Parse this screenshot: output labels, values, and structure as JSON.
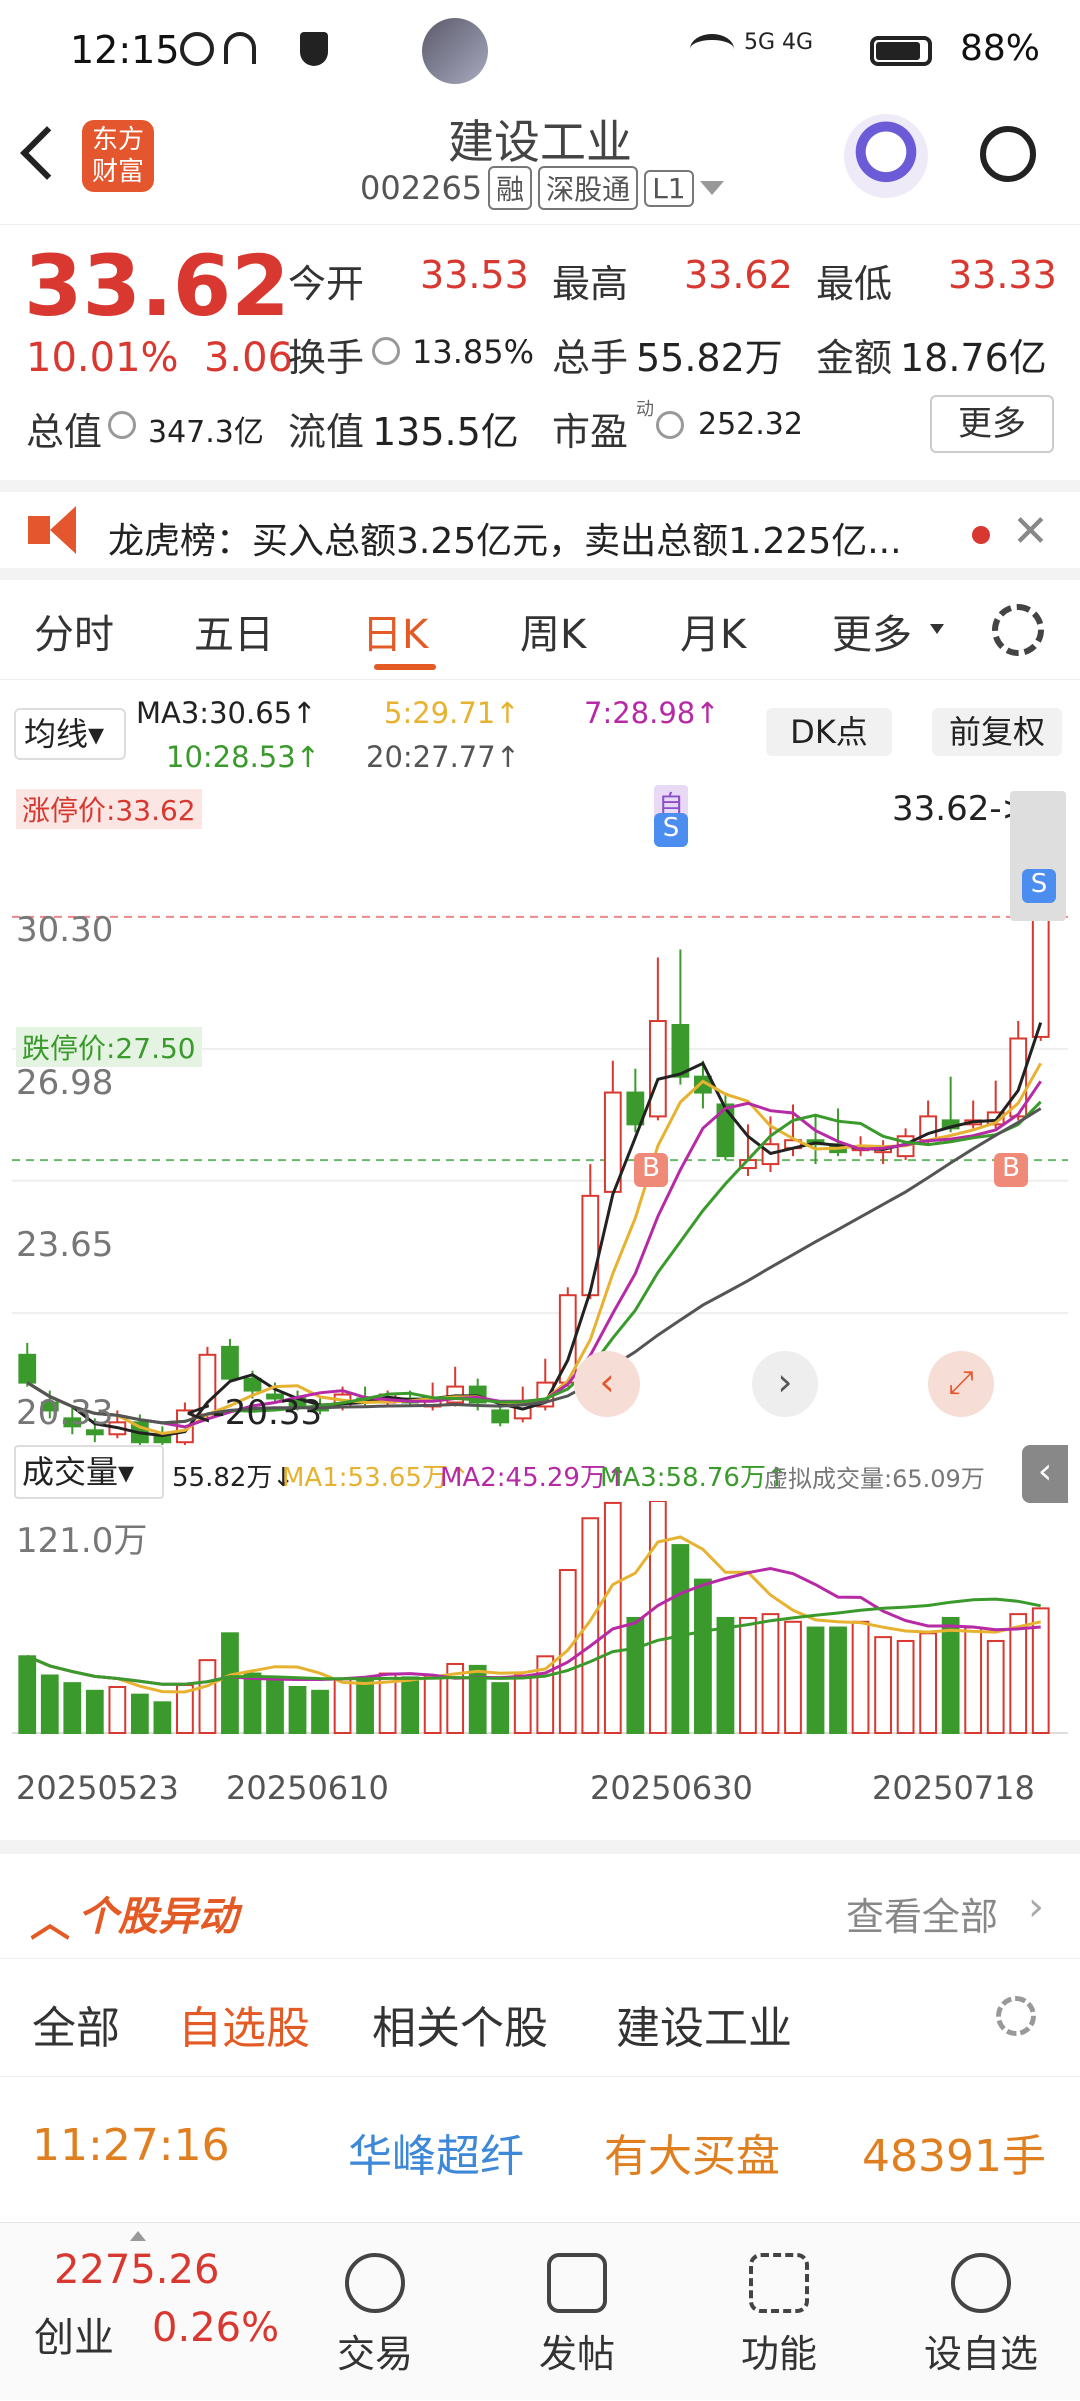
{
  "status": {
    "time": "12:15",
    "battery": "88%",
    "net": "5G 4G"
  },
  "nav": {
    "title": "建设工业",
    "code": "002265",
    "tag1": "融",
    "tag2": "深股通",
    "tag3": "L1",
    "logo_text": "东方财富",
    "back_icon": "chevron-left-icon",
    "search_icon": "search-icon"
  },
  "quote": {
    "price": "33.62",
    "change_pct": "10.01%",
    "change_amt": "3.06",
    "open_label": "今开",
    "open": "33.53",
    "high_label": "最高",
    "high": "33.62",
    "low_label": "最低",
    "low": "33.33",
    "turnover_label": "换手",
    "turnover": "13.85%",
    "volume_label": "总手",
    "volume": "55.82万",
    "amount_label": "金额",
    "amount": "18.76亿",
    "mktcap_label": "总值",
    "mktcap": "347.3亿",
    "float_label": "流值",
    "float": "135.5亿",
    "pe_label": "市盈",
    "pe_sup": "动",
    "pe": "252.32",
    "more": "更多"
  },
  "notice": {
    "text": "龙虎榜：买入总额3.25亿元，卖出总额1.225亿..."
  },
  "tabs": [
    {
      "label": "分时"
    },
    {
      "label": "五日"
    },
    {
      "label": "日K"
    },
    {
      "label": "周K"
    },
    {
      "label": "月K"
    },
    {
      "label": "更多"
    }
  ],
  "chart_controls": {
    "indicator": "均线",
    "ma3": "MA3:30.65↑",
    "ma5": "5:29.71↑",
    "ma7": "7:28.98↑",
    "ma10": "10:28.53↑",
    "ma20": "20:27.77↑",
    "dk": "DK点",
    "adjust": "前复权"
  },
  "kline": {
    "limit_up_label": "涨停价:33.62",
    "limit_down_label": "跌停价:27.50",
    "y_top": "36.?",
    "y1": "30.30",
    "y2": "26.98",
    "y3": "23.65",
    "y4": "20.33",
    "low_marker": "<-20.33",
    "last_marker": "33.62->",
    "self_tag": "自"
  },
  "volume": {
    "indicator": "成交量",
    "vol": "55.82万↓",
    "ma1": "MA1:53.65万↑",
    "ma2": "MA2:45.29万↑",
    "ma3": "MA3:58.76万↑",
    "virtual": "虚拟成交量:65.09万",
    "ytop": "121.0万",
    "dates": [
      "20250523",
      "20250610",
      "20250630",
      "20250718"
    ]
  },
  "movers": {
    "title": "个股异动",
    "view_all": "查看全部",
    "tabs": [
      {
        "label": "全部"
      },
      {
        "label": "自选股"
      },
      {
        "label": "相关个股"
      },
      {
        "label": "建设工业"
      }
    ],
    "row": {
      "time": "11:27:16",
      "name": "华峰超纤",
      "event": "有大买盘",
      "qty": "48391手"
    }
  },
  "bottom": {
    "index_value": "2275.26",
    "index_name": "创业",
    "index_chg": "0.26%",
    "items": [
      {
        "label": "交易"
      },
      {
        "label": "发帖"
      },
      {
        "label": "功能"
      },
      {
        "label": "设自选"
      }
    ]
  },
  "colors": {
    "up": "#d8382f",
    "down": "#3a9a2c",
    "accent": "#e45a24"
  },
  "chart_data": {
    "type": "candlestick",
    "ylim": [
      20.33,
      36.94
    ],
    "dates_shown": [
      "20250523",
      "20250610",
      "20250630",
      "20250718"
    ],
    "candles": [
      [
        22.6,
        21.9,
        22.9,
        21.8
      ],
      [
        21.4,
        21.2,
        21.7,
        21.0
      ],
      [
        21.0,
        20.8,
        21.3,
        20.6
      ],
      [
        20.7,
        20.6,
        21.0,
        20.4
      ],
      [
        20.6,
        20.9,
        21.2,
        20.5
      ],
      [
        20.9,
        20.4,
        21.1,
        20.33
      ],
      [
        20.6,
        20.4,
        20.8,
        20.33
      ],
      [
        20.4,
        21.2,
        21.4,
        20.3
      ],
      [
        21.1,
        22.6,
        22.8,
        21.0
      ],
      [
        22.8,
        22.0,
        23.0,
        21.9
      ],
      [
        22.0,
        21.7,
        22.2,
        21.5
      ],
      [
        21.6,
        21.5,
        21.9,
        21.4
      ],
      [
        21.5,
        21.3,
        21.7,
        21.2
      ],
      [
        21.3,
        21.2,
        21.5,
        21.1
      ],
      [
        21.3,
        21.6,
        21.8,
        21.2
      ],
      [
        21.5,
        21.4,
        21.8,
        21.3
      ],
      [
        21.4,
        21.6,
        21.7,
        21.3
      ],
      [
        21.5,
        21.4,
        21.7,
        21.3
      ],
      [
        21.3,
        21.5,
        21.9,
        21.2
      ],
      [
        21.4,
        21.8,
        22.3,
        21.3
      ],
      [
        21.8,
        21.4,
        22.0,
        21.2
      ],
      [
        21.2,
        20.9,
        21.4,
        20.8
      ],
      [
        21.0,
        21.4,
        21.8,
        20.9
      ],
      [
        21.3,
        21.9,
        22.5,
        21.2
      ],
      [
        21.9,
        24.1,
        24.3,
        21.8
      ],
      [
        24.1,
        26.6,
        27.4,
        24.0
      ],
      [
        26.7,
        29.2,
        30.0,
        26.6
      ],
      [
        29.2,
        28.4,
        29.8,
        28.2
      ],
      [
        28.6,
        31.0,
        32.6,
        28.5
      ],
      [
        30.9,
        29.6,
        32.8,
        29.4
      ],
      [
        29.6,
        29.2,
        30.0,
        28.8
      ],
      [
        28.9,
        27.6,
        29.2,
        27.5
      ],
      [
        27.3,
        27.5,
        28.4,
        27.1
      ],
      [
        27.4,
        27.9,
        28.6,
        27.2
      ],
      [
        27.8,
        28.0,
        28.9,
        27.6
      ],
      [
        28.0,
        27.9,
        28.6,
        27.4
      ],
      [
        27.9,
        27.7,
        28.8,
        27.6
      ],
      [
        27.8,
        27.8,
        28.1,
        27.6
      ],
      [
        27.7,
        27.8,
        28.0,
        27.4
      ],
      [
        27.6,
        28.1,
        28.3,
        27.5
      ],
      [
        28.0,
        28.6,
        29.0,
        27.9
      ],
      [
        28.5,
        28.3,
        29.6,
        28.2
      ],
      [
        28.4,
        28.5,
        29.0,
        28.3
      ],
      [
        28.4,
        28.7,
        29.5,
        28.3
      ],
      [
        28.6,
        30.56,
        31.0,
        28.5
      ],
      [
        30.6,
        33.62,
        33.62,
        30.5
      ]
    ],
    "volumes": [
      40,
      30,
      26,
      22,
      24,
      20,
      16,
      25,
      38,
      52,
      31,
      27,
      24,
      22,
      28,
      28,
      31,
      29,
      30,
      36,
      35,
      26,
      30,
      40,
      85,
      112,
      120,
      60,
      121,
      98,
      80,
      60,
      60,
      62,
      58,
      55,
      55,
      58,
      50,
      48,
      52,
      60,
      55,
      48,
      62,
      65
    ]
  }
}
